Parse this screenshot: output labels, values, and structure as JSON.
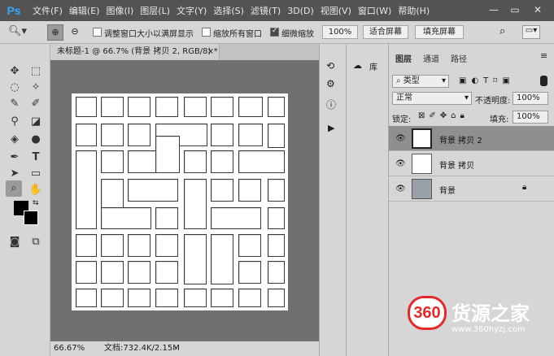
{
  "app": {
    "logo": "Ps"
  },
  "menu": [
    "文件(F)",
    "编辑(E)",
    "图像(I)",
    "图层(L)",
    "文字(Y)",
    "选择(S)",
    "滤镜(T)",
    "3D(D)",
    "视图(V)",
    "窗口(W)",
    "帮助(H)"
  ],
  "window_controls": {
    "minimize": "—",
    "restore": "▭",
    "close": "✕"
  },
  "options": {
    "resize_windows_label": "调整窗口大小以满屏显示",
    "zoom_all_label": "缩放所有窗口",
    "scrubby_zoom_label": "细微缩放",
    "zoom_value": "100%",
    "fit_screen_label": "适合屏幕",
    "fill_screen_label": "填充屏幕"
  },
  "document": {
    "tab_title": "未标题-1 @ 66.7% (背景 拷贝 2, RGB/8) *",
    "zoom": "66.67%",
    "doc_info": "文档:732.4K/2.15M"
  },
  "library": {
    "label": "库"
  },
  "layers_panel": {
    "tabs": [
      "图层",
      "通道",
      "路径"
    ],
    "filter_kind": "类型",
    "blend_mode": "正常",
    "opacity_label": "不透明度:",
    "opacity_value": "100%",
    "lock_label": "锁定:",
    "fill_label": "填充:",
    "fill_value": "100%",
    "layers": [
      {
        "name": "背景 拷贝 2",
        "selected": true
      },
      {
        "name": "背景 拷贝",
        "selected": false
      },
      {
        "name": "背景",
        "selected": false,
        "locked": true
      }
    ]
  },
  "watermark": {
    "logo": "360",
    "name": "货源之家",
    "url": "www.360hyzj.com"
  }
}
